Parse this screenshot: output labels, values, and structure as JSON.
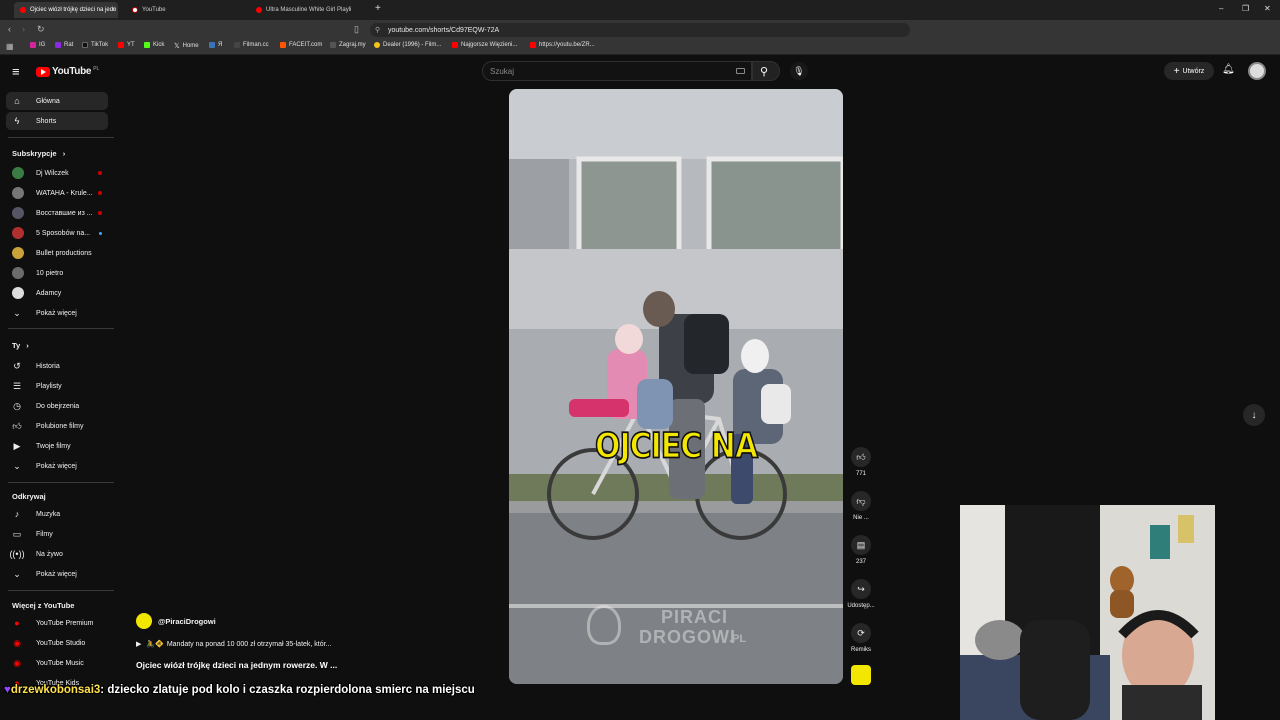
{
  "browser": {
    "tabs": [
      {
        "title": "Ojciec wiózł trójkę dzieci na jedn",
        "active": true,
        "color": "#ff0000"
      },
      {
        "title": "YouTube",
        "active": false,
        "color": "#ffffff"
      },
      {
        "title": "Ultra Masculine White Girl Playli",
        "active": false,
        "color": "#ff0000"
      }
    ],
    "new_tab": "+",
    "url": "youtube.com/shorts/Cd97EQW-72A",
    "bookmarks": [
      {
        "label": "IG",
        "color": "#d6249f"
      },
      {
        "label": "Rat",
        "color": "#8a2be2"
      },
      {
        "label": "TikTok",
        "color": "#111111"
      },
      {
        "label": "YT",
        "color": "#ff0000"
      },
      {
        "label": "Kick",
        "color": "#53fc18"
      },
      {
        "label": "Home",
        "color": "#000000"
      },
      {
        "label": "Я",
        "color": "#3b73b9"
      },
      {
        "label": "Filman.cc",
        "color": "#444444"
      },
      {
        "label": "FACEIT.com",
        "color": "#ff5500"
      },
      {
        "label": "Zagraj.my",
        "color": "#555555"
      },
      {
        "label": "Dealer (1996) - Film...",
        "color": "#f5c518"
      },
      {
        "label": "Najgorsze Więzieni...",
        "color": "#ff0000"
      },
      {
        "label": "https://youtu.be/ZR...",
        "color": "#ff0000"
      }
    ]
  },
  "youtube": {
    "logo_text": "YouTube",
    "logo_region": "PL",
    "search_placeholder": "Szukaj",
    "create_label": "Utwórz",
    "sidebar": {
      "top": [
        {
          "label": "Główna",
          "icon": "home-icon",
          "active": true
        },
        {
          "label": "Shorts",
          "icon": "shorts-icon",
          "active": false
        }
      ],
      "subs_heading": "Subskrypcje",
      "subs": [
        {
          "label": "Dj Wilczek",
          "color": "#3a7d44",
          "live": true
        },
        {
          "label": "WATAHA - Krule...",
          "color": "#777777",
          "live": true
        },
        {
          "label": "Восставшие из ...",
          "color": "#555566",
          "live": true
        },
        {
          "label": "5 Sposobów na...",
          "color": "#b03030",
          "live": false
        },
        {
          "label": "Bullet productions",
          "color": "#c9a23a",
          "live": false
        },
        {
          "label": "10 pietro",
          "color": "#6b6b6b",
          "live": false
        },
        {
          "label": "Adamcy",
          "color": "#dddddd",
          "live": false
        }
      ],
      "subs_more": "Pokaż więcej",
      "you_heading": "Ty",
      "you": [
        {
          "label": "Historia",
          "icon": "history-icon"
        },
        {
          "label": "Playlisty",
          "icon": "playlist-icon"
        },
        {
          "label": "Do obejrzenia",
          "icon": "clock-icon"
        },
        {
          "label": "Polubione filmy",
          "icon": "like-icon"
        },
        {
          "label": "Twoje filmy",
          "icon": "video-icon"
        }
      ],
      "you_more": "Pokaż więcej",
      "explore_heading": "Odkrywaj",
      "explore": [
        {
          "label": "Muzyka",
          "icon": "music-icon"
        },
        {
          "label": "Filmy",
          "icon": "film-icon"
        },
        {
          "label": "Na żywo",
          "icon": "live-icon"
        }
      ],
      "explore_more": "Pokaż więcej",
      "more_heading": "Więcej z YouTube",
      "more": [
        {
          "label": "YouTube Premium"
        },
        {
          "label": "YouTube Studio"
        },
        {
          "label": "YouTube Music"
        },
        {
          "label": "YouTube Kids"
        }
      ]
    },
    "short": {
      "caption": "OJCIEC NA",
      "watermark_line1": "PIRACI",
      "watermark_line2": "DROGOWI",
      "watermark_suffix": ".PL",
      "channel": "@PiraciDrogowi",
      "description": "Mandaty na ponad 10 000 zł otrzymał 35-latek, któr...",
      "title": "Ojciec wiózł trójkę dzieci na jednym rowerze. W ...",
      "actions": [
        {
          "label": "771",
          "icon": "thumbs-up-icon"
        },
        {
          "label": "Nie ...",
          "icon": "thumbs-down-icon"
        },
        {
          "label": "237",
          "icon": "comment-icon"
        },
        {
          "label": "Udostęp...",
          "icon": "share-icon"
        },
        {
          "label": "Remiks",
          "icon": "remix-icon"
        }
      ]
    }
  },
  "chat": {
    "username": "drzewkobonsai3",
    "message": ": dziecko zlatuje pod kolo i czaszka rozpierdolona smierc na miejscu",
    "username_color": "#ffe14d",
    "badge_color": "#9146ff"
  },
  "colors": {
    "youtube_red": "#ff0000",
    "caption_yellow": "#f3e600",
    "background": "#0f0f0f"
  }
}
